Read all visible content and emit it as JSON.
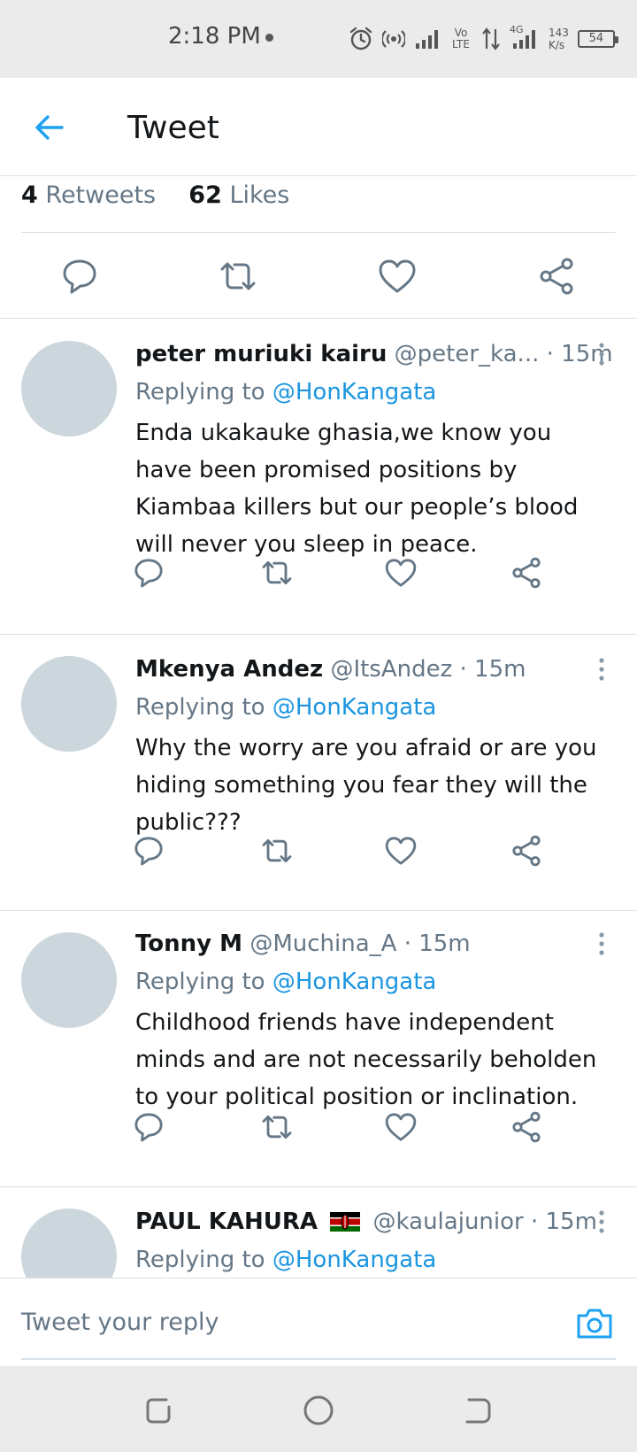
{
  "status_bar": {
    "time": "2:18 PM",
    "network_speed_value": "143",
    "network_speed_unit": "K/s",
    "battery_level": "54",
    "volte": "Vo LTE",
    "network_type": "4G"
  },
  "header": {
    "title": "Tweet",
    "back_icon": "arrow-left-icon"
  },
  "stats": {
    "retweets_count": "4",
    "retweets_label": "Retweets",
    "likes_count": "62",
    "likes_label": "Likes"
  },
  "replies": [
    {
      "name": "peter muriuki kairu",
      "handle": "@peter_ka...",
      "time": "· 15m",
      "replying_label": "Replying to",
      "replying_to": "@HonKangata",
      "text": "Enda ukakauke ghasia,we know you have been promised positions by Kiambaa killers but our people’s blood will never you sleep in peace."
    },
    {
      "name": "Mkenya Andez",
      "handle": "@ItsAndez",
      "time": "· 15m",
      "replying_label": "Replying to",
      "replying_to": "@HonKangata",
      "text": "Why the worry are you afraid or are you hiding something you fear they will the public???"
    },
    {
      "name": "Tonny M",
      "handle": "@Muchina_A",
      "time": "· 15m",
      "replying_label": "Replying to",
      "replying_to": "@HonKangata",
      "text": "Childhood friends have independent minds and are not necessarily beholden to your political position or inclination."
    },
    {
      "name": "PAUL KAHURA",
      "handle": "@kaulajunior",
      "time": "· 15m",
      "replying_label": "Replying to",
      "replying_to": "@HonKangata",
      "text": ""
    }
  ],
  "compose": {
    "placeholder": "Tweet your reply",
    "camera_icon": "camera-icon"
  },
  "colors": {
    "accent": "#1DA1F2",
    "mention": "#1B95E0",
    "secondary_text": "#657786",
    "avatar_placeholder": "#CCD6DD"
  }
}
